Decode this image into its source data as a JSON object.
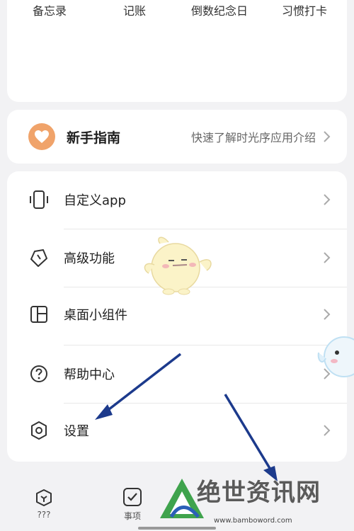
{
  "quick_items": [
    "备忘录",
    "记账",
    "倒数纪念日",
    "习惯打卡"
  ],
  "guide": {
    "title": "新手指南",
    "subtitle": "快速了解时光序应用介绍"
  },
  "menu": [
    {
      "label": "自定义app",
      "icon": "phone-frame-icon"
    },
    {
      "label": "高级功能",
      "icon": "tag-icon"
    },
    {
      "label": "桌面小组件",
      "icon": "widget-grid-icon"
    },
    {
      "label": "帮助中心",
      "icon": "help-circle-icon"
    },
    {
      "label": "设置",
      "icon": "gear-icon"
    }
  ],
  "tabbar": {
    "tab1_label": "???",
    "tab2_label": "事项"
  },
  "watermark": {
    "text": "绝世资讯网",
    "url": "www.bamboword.com"
  },
  "colors": {
    "guide_icon": "#f0a36a",
    "arrow": "#1c3a8c"
  }
}
